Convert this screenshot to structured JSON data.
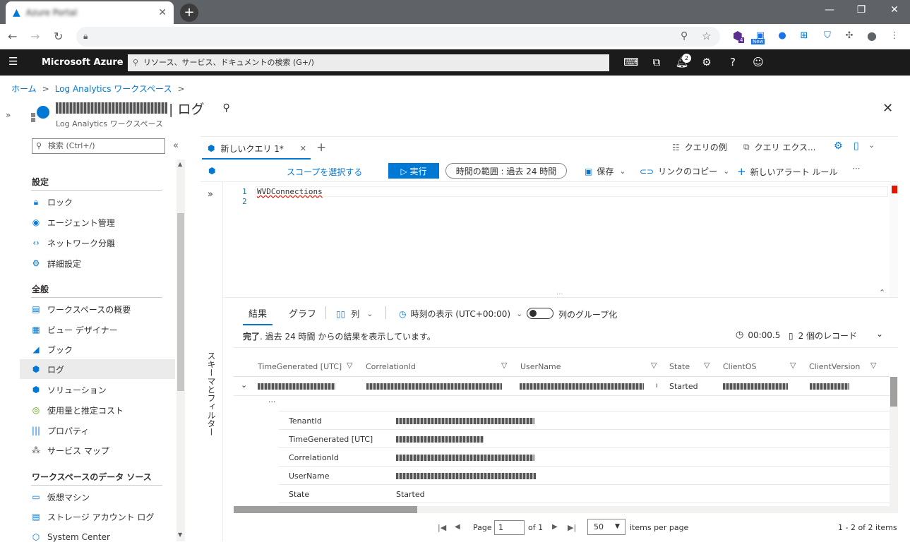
{
  "browser": {
    "tab_title": "Azure Portal",
    "new_tab": "+",
    "ext_badge_new": "New",
    "ext_badge_count": "4"
  },
  "azure": {
    "brand": "Microsoft Azure",
    "search_placeholder": "リソース、サービス、ドキュメントの検索 (G+/)",
    "notification_count": "2"
  },
  "breadcrumb": {
    "home": "ホーム",
    "sep": ">",
    "workspace": "Log Analytics ワークスペース"
  },
  "blade": {
    "title_suffix": "| ログ",
    "subtitle": "Log Analytics ワークスペース"
  },
  "sidebar": {
    "search_placeholder": "検索 (Ctrl+/)",
    "sections": {
      "settings": "設定",
      "general": "全般",
      "datasources": "ワークスペースのデータ ソース"
    },
    "items": {
      "lock": "ロック",
      "agents": "エージェント管理",
      "network": "ネットワーク分離",
      "advanced": "詳細設定",
      "overview": "ワークスペースの概要",
      "designer": "ビュー デザイナー",
      "books": "ブック",
      "logs": "ログ",
      "solutions": "ソリューション",
      "usage": "使用量と推定コスト",
      "properties": "プロパティ",
      "servicemap": "サービス マップ",
      "vm": "仮想マシン",
      "storage": "ストレージ アカウント ログ",
      "syscenter": "System Center"
    }
  },
  "query": {
    "tab_label": "新しいクエリ 1*",
    "examples": "クエリの例",
    "explorer": "クエリ エクス...",
    "scope": "スコープを選択する",
    "run": "▷ 実行",
    "timerange": "時間の範囲 : 過去 24 時間",
    "save": "保存",
    "copy_link": "リンクのコピー",
    "new_alert": "新しいアラート ルール",
    "more": "···",
    "line1": "1",
    "line2": "2",
    "code": "WVDConnections",
    "schema_filter": "スキーマとフィルター"
  },
  "results": {
    "tab_results": "結果",
    "tab_chart": "グラフ",
    "columns_btn": "列",
    "timezone": "時刻の表示 (UTC+00:00)",
    "group": "列のグループ化",
    "status_bold": "完了",
    "status_rest": ". 過去 24 時間 からの結果を表示しています。",
    "elapsed": "00:00.5",
    "records": "2 個のレコード",
    "headers": [
      "TimeGenerated [UTC]",
      "CorrelationId",
      "UserName",
      "State",
      "ClientOS",
      "ClientVersion"
    ],
    "row_state": "Started",
    "row_prefix": "ı",
    "ellipsis": "···",
    "detail_keys": [
      "TenantId",
      "TimeGenerated [UTC]",
      "CorrelationId",
      "UserName",
      "State"
    ],
    "detail_state": "Started"
  },
  "pager": {
    "page_label": "Page",
    "page_value": "1",
    "of": "of 1",
    "page_size": "50",
    "per_page": "items per page",
    "summary": "1 - 2 of 2 items"
  },
  "colors": {
    "azure_blue": "#0078d4",
    "header_bg": "#1b1b1b",
    "chrome_bg": "#5f6368"
  }
}
